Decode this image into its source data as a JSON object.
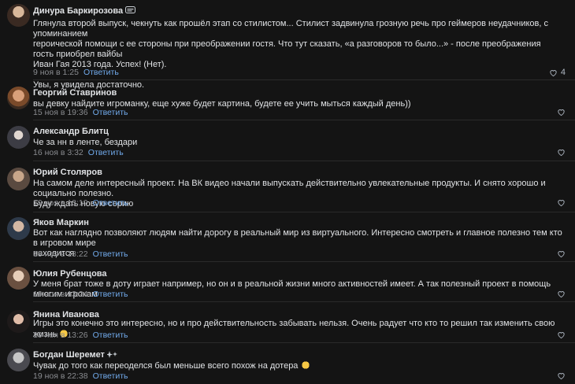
{
  "comments": [
    {
      "author": "Динура Баркирозова",
      "text": [
        "Глянула второй выпуск, чекнуть как прошёл этап со стилистом... Стилист задвинула грозную речь про геймеров неудачников, с упоминанием",
        "героической помощи с ее стороны при преображении гостя. Что тут сказать, «а разговоров то было...» - после преображения гость приобрел вайбы",
        "Иван Гая 2013 года. Успех! (Нет).",
        "",
        "Увы, я увидела достаточно."
      ],
      "date": "9 ноя в 1:25",
      "reply": "Ответить",
      "likes": "4"
    },
    {
      "author": "Георгий Ставринов",
      "text": [
        "вы девку найдите игроманку, еще хуже будет картина, будете ее учить мыться каждый день))"
      ],
      "date": "15 ноя в 19:36",
      "reply": "Ответить",
      "likes": ""
    },
    {
      "author": "Александр Блитц",
      "text": [
        "Че за нн в ленте, бездари"
      ],
      "date": "16 ноя в 3:32",
      "reply": "Ответить",
      "likes": ""
    },
    {
      "author": "Юрий Столяров",
      "text": [
        "На самом деле интересный проект. На ВК видео начали выпускать действительно увлекательные продукты. И снято хорошо и социально полезно.",
        "Буду ждать новую серию"
      ],
      "date": "19 ноя в 13:19",
      "reply": "Ответить",
      "likes": ""
    },
    {
      "author": "Яков Маркин",
      "text": [
        "Вот как наглядно позволяют людям найти дорогу в реальный мир из виртуального. Интересно смотреть и главное полезно тем кто в игровом мире",
        "находится"
      ],
      "date": "19 ноя в 13:22",
      "reply": "Ответить",
      "likes": ""
    },
    {
      "author": "Юлия Рубенцова",
      "text": [
        "У меня брат тоже в доту играет например, но он и в реальной жизни много активностей имеет. А так полезный проект в помощь многим игрокам"
      ],
      "date": "19 ноя в 13:24",
      "reply": "Ответить",
      "likes": ""
    },
    {
      "author": "Янина Иванова",
      "text": [
        "Игры это конечно это интересно, но и про действительность забывать нельзя. Очень радует что кто то решил так изменить свою жизнь"
      ],
      "date": "19 ноя в 13:26",
      "reply": "Ответить",
      "likes": ""
    },
    {
      "author": "Богдан Шеремет",
      "text": [
        "Чувак до того как переоделся был меньше всего похож на дотера"
      ],
      "date": "19 ноя в 22:38",
      "reply": "Ответить",
      "likes": ""
    }
  ]
}
